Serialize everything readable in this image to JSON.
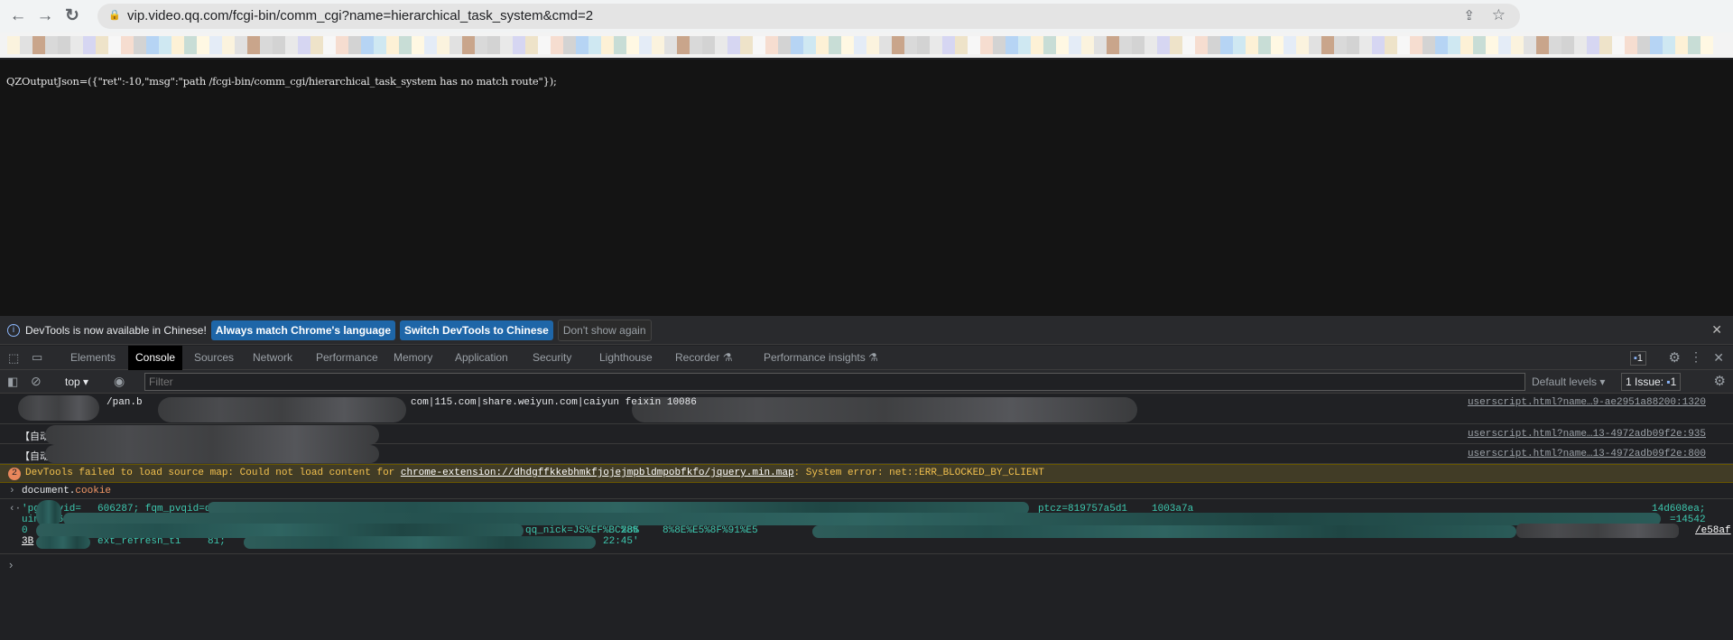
{
  "browser": {
    "url": "vip.video.qq.com/fcgi-bin/comm_cgi?name=hierarchical_task_system&cmd=2"
  },
  "page": {
    "text": "QZOutputJson=({\"ret\":-10,\"msg\":\"path /fcgi-bin/comm_cgi/hierarchical_task_system has no match route\"});"
  },
  "infobar": {
    "message": "DevTools is now available in Chinese!",
    "btn_match": "Always match Chrome's language",
    "btn_switch": "Switch DevTools to Chinese",
    "btn_dismiss": "Don't show again"
  },
  "tabs": [
    "Elements",
    "Console",
    "Sources",
    "Network",
    "Performance",
    "Memory",
    "Application",
    "Security",
    "Lighthouse",
    "Recorder ⚗",
    "Performance insights ⚗"
  ],
  "tabs_badge": "1",
  "console_toolbar": {
    "context": "top",
    "filter_placeholder": "Filter",
    "levels": "Default levels",
    "issues_label": "1 Issue:",
    "issues_count": "1"
  },
  "messages": [
    {
      "text": "/pan.b",
      "text2": "com|115.com|share.weiyun.com|caiyun feixin 10086",
      "source": "userscript.html?name…9-ae2951a88200:1320"
    },
    {
      "text": "【自动",
      "source": "userscript.html?name…13-4972adb09f2e:935"
    },
    {
      "text": "【自动",
      "source": "userscript.html?name…13-4972adb09f2e:800"
    }
  ],
  "warning": {
    "count": "2",
    "prefix": "DevTools failed to load source map: Could not load content for ",
    "link": "chrome-extension://dhdgffkkebhmkfjojejmpbldmpobfkfo/jquery.min.map",
    "suffix": ": System error: net::ERR_BLOCKED_BY_CLIENT"
  },
  "command": {
    "text": "document.",
    "prop": "cookie"
  },
  "result": {
    "l1a": "'pgv_pvid=",
    "l1b": "606287; fqm_pvqid=d7",
    "l1c": "ptcz=819757a5d1",
    "l1d": "1003a7a",
    "l1e": "14d608ea;",
    "l2a": "uin=o16473",
    "l2b": "=14542",
    "l3a": "0",
    "l3b": "qq_nick=JS%EF%BC%86",
    "l3c": "2B%",
    "l3d": "8%8E%E5%8F%91%E5",
    "l3e": "/e58af",
    "l4a": "3B",
    "l4b": "ext_refresh_ti",
    "l4c": "81;",
    "l4d": "22:45'"
  }
}
